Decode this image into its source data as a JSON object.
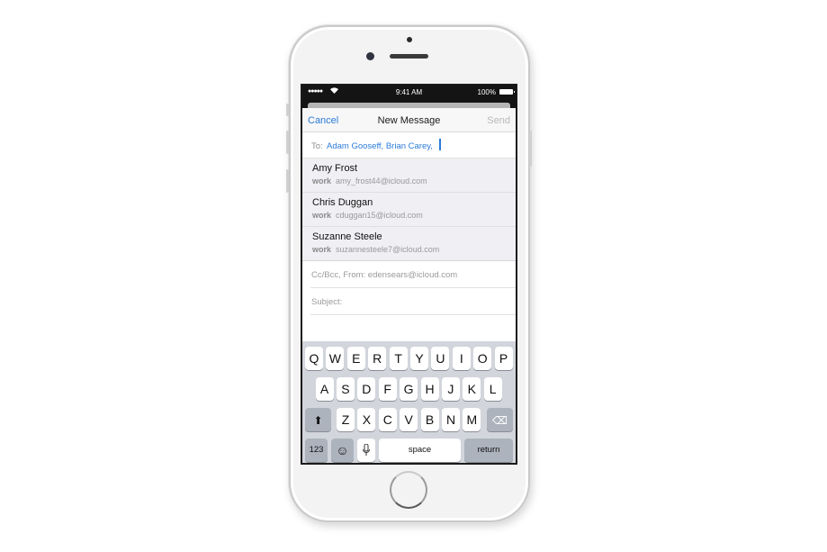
{
  "status_bar": {
    "signal": "●●●●●",
    "wifi_icon": "wifi-icon",
    "time": "9:41 AM",
    "battery_percent": "100%",
    "battery_icon": "battery-icon"
  },
  "nav": {
    "cancel_label": "Cancel",
    "title": "New Message",
    "send_label": "Send"
  },
  "to_field": {
    "label": "To:",
    "recipients": "Adam Gooseff, Brian Carey,"
  },
  "suggestions": [
    {
      "name": "Amy Frost",
      "kind": "work",
      "email": "amy_frost44@icloud.com"
    },
    {
      "name": "Chris Duggan",
      "kind": "work",
      "email": "cduggan15@icloud.com"
    },
    {
      "name": "Suzanne Steele",
      "kind": "work",
      "email": "suzannesteele7@icloud.com"
    }
  ],
  "cc_field": {
    "label": "Cc/Bcc, From: edensears@icloud.com"
  },
  "subject_field": {
    "label": "Subject:"
  },
  "keyboard": {
    "row1": [
      "Q",
      "W",
      "E",
      "R",
      "T",
      "Y",
      "U",
      "I",
      "O",
      "P"
    ],
    "row2": [
      "A",
      "S",
      "D",
      "F",
      "G",
      "H",
      "J",
      "K",
      "L"
    ],
    "row3": [
      "Z",
      "X",
      "C",
      "V",
      "B",
      "N",
      "M"
    ],
    "shift_icon": "⬆",
    "delete_icon": "⌫",
    "numbers_label": "123",
    "emoji_icon": "☺",
    "mic_icon": "🎙",
    "space_label": "space",
    "return_label": "return"
  }
}
